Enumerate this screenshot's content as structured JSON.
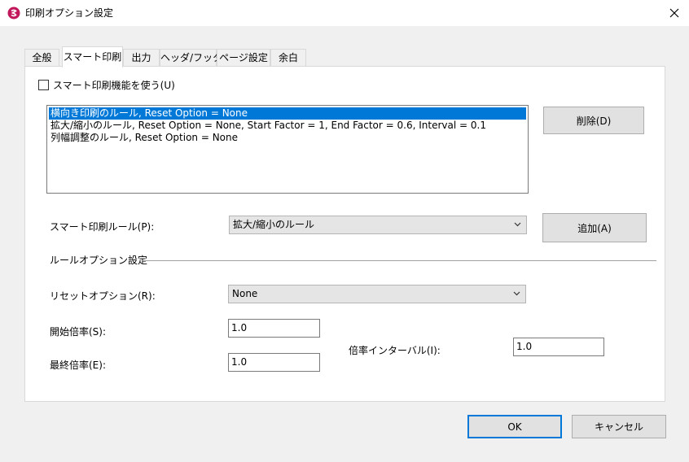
{
  "window": {
    "title": "印刷オプション設定",
    "icon": "app-logo-icon",
    "close_icon": "close-icon"
  },
  "tabs": [
    {
      "label": "全般"
    },
    {
      "label": "スマート印刷"
    },
    {
      "label": "出力"
    },
    {
      "label": "ヘッダ/フッタ"
    },
    {
      "label": "ページ設定"
    },
    {
      "label": "余白"
    }
  ],
  "active_tab": "スマート印刷",
  "smart_print": {
    "enable_label": "スマート印刷機能を使う(U)",
    "enable_checked": false,
    "rules": [
      "横向き印刷のルール, Reset Option = None",
      "拡大/縮小のルール, Reset Option = None, Start Factor = 1, End Factor = 0.6, Interval = 0.1",
      "列幅調整のルール, Reset Option = None"
    ],
    "selected_rule_index": 0,
    "delete_label": "削除(D)",
    "rule_label": "スマート印刷ルール(P):",
    "rule_value": "拡大/縮小のルール",
    "add_label": "追加(A)"
  },
  "rule_options": {
    "group_label": "ルールオプション設定",
    "reset_label": "リセットオプション(R):",
    "reset_value": "None",
    "start_label": "開始倍率(S):",
    "start_value": "1.0",
    "end_label": "最終倍率(E):",
    "end_value": "1.0",
    "interval_label": "倍率インターバル(I):",
    "interval_value": "1.0"
  },
  "footer": {
    "ok_label": "OK",
    "cancel_label": "キャンセル"
  },
  "colors": {
    "accent": "#0078d7",
    "logo": "#c2185b"
  }
}
